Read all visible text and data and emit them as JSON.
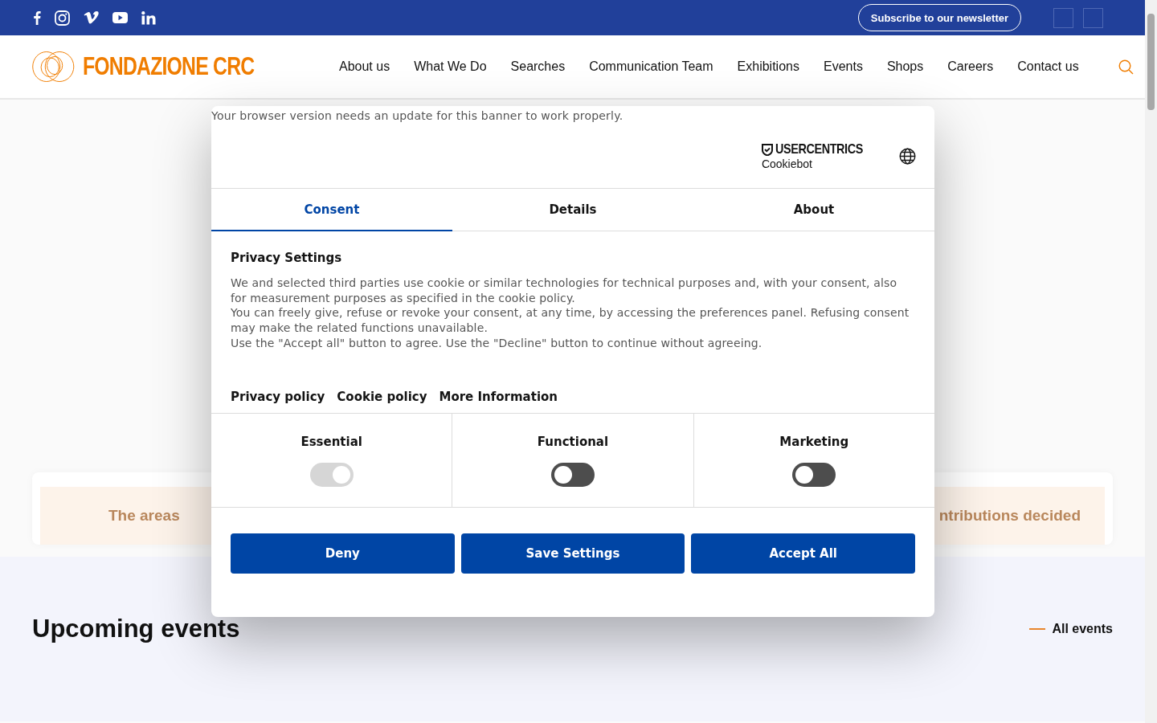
{
  "top_bar": {
    "newsletter_button": "Subscribe to our newsletter"
  },
  "header": {
    "logo": "FONDAZIONE CRC",
    "nav": [
      "About us",
      "What We Do",
      "Searches",
      "Communication Team",
      "Exhibitions",
      "Events",
      "Shops",
      "Careers",
      "Contact us"
    ]
  },
  "hero_card": {
    "items": [
      "The areas",
      "ntributions decided"
    ]
  },
  "events_section": {
    "title": "Upcoming events",
    "link": "All events"
  },
  "cookie_dialog": {
    "notice": "Your browser version needs an update for this banner to work properly.",
    "brand": "USERCENTRICS",
    "brand_sub": "Cookiebot",
    "tabs": [
      {
        "label": "Consent",
        "selected": true
      },
      {
        "label": "Details",
        "selected": false
      },
      {
        "label": "About",
        "selected": false
      }
    ],
    "heading": "Privacy Settings",
    "paragraphs": [
      "We and selected third parties use cookie or similar technologies for technical purposes and, with your consent, also for measurement purposes as specified in the cookie policy.",
      "You can freely give, refuse or revoke your consent, at any time, by accessing the preferences panel. Refusing consent may make the related functions unavailable.",
      "Use the \"Accept all\" button to agree. Use the \"Decline\" button to continue without agreeing."
    ],
    "links": [
      "Privacy policy",
      "Cookie policy",
      "More Information"
    ],
    "categories": [
      {
        "label": "Essential",
        "on": true,
        "disabled": true
      },
      {
        "label": "Functional",
        "on": false,
        "disabled": false
      },
      {
        "label": "Marketing",
        "on": false,
        "disabled": false
      }
    ],
    "buttons": [
      "Deny",
      "Save Settings",
      "Accept All"
    ]
  }
}
